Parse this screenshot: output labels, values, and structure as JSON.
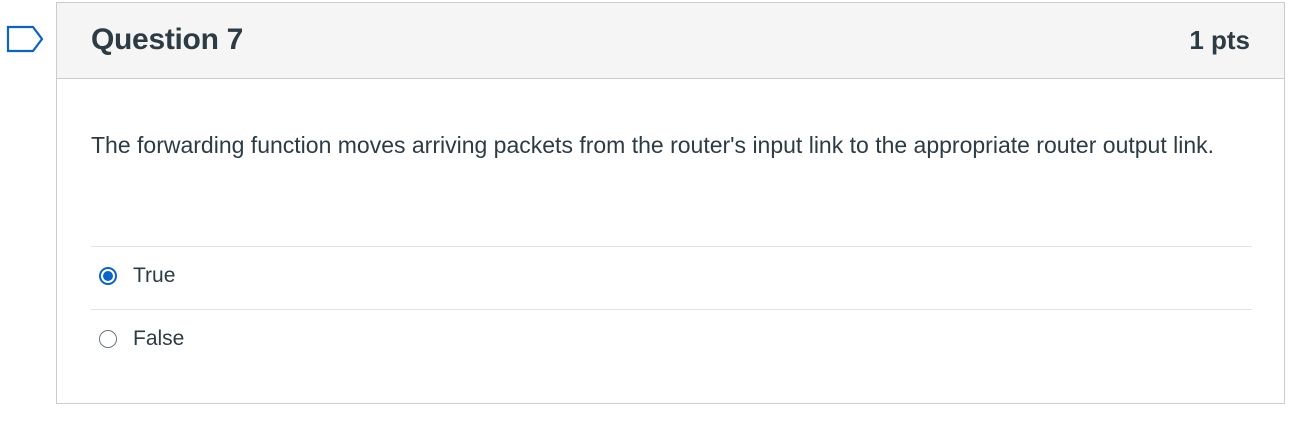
{
  "question": {
    "title": "Question 7",
    "points": "1 pts",
    "text": "The forwarding function moves arriving packets from the router's input link to the appropriate router output link.",
    "answers": [
      {
        "label": "True",
        "selected": true
      },
      {
        "label": "False",
        "selected": false
      }
    ]
  },
  "colors": {
    "accent": "#0b63c5",
    "flag_outline": "#0b63c5",
    "header_bg": "#f5f5f5",
    "text": "#2d3b45"
  },
  "icons": {
    "flag": "flag-bookmark-icon"
  }
}
